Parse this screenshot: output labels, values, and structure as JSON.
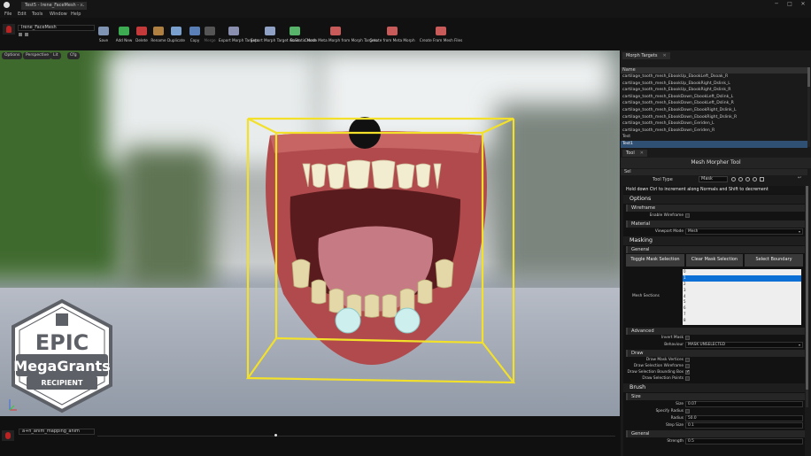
{
  "titlebar": {
    "tab_title": "Test5 - Irene_FaceMesh - ...",
    "close": "✕",
    "minimize": "─",
    "maximize": "□",
    "window_close": "✕"
  },
  "menu": {
    "file": "File",
    "edit": "Edit",
    "tools": "Tools",
    "window": "Window",
    "help": "Help"
  },
  "asset": {
    "name": "Irene_FaceMesh"
  },
  "toolbar": [
    {
      "label": "Save",
      "color": "#7f93b3"
    },
    {
      "label": "Add New",
      "color": "#3cab52"
    },
    {
      "label": "Delete",
      "color": "#c43a3a"
    },
    {
      "label": "Rename",
      "color": "#b08040"
    },
    {
      "label": "Duplicate",
      "color": "#7aa0d0"
    },
    {
      "label": "Copy",
      "color": "#5a7fb6"
    },
    {
      "label": "Merge",
      "color": "#555555"
    },
    {
      "label": "Export Morph Targets",
      "color": "#8a8fb0"
    },
    {
      "label": "Export Morph Target As Static Mesh",
      "color": "#8fa2c6"
    },
    {
      "label": "Bake",
      "color": "#58b36a"
    },
    {
      "label": "Create Meta Morph from Morph Targets",
      "color": "#c85a5a"
    },
    {
      "label": "Create from Meta Morph",
      "color": "#c85a5a"
    },
    {
      "label": "Create From Mesh Files",
      "color": "#c85a5a"
    }
  ],
  "viewport": {
    "options": "Options",
    "perspective": "Perspective",
    "lit": "Lit",
    "show": "Cfg"
  },
  "badge": {
    "line1": "EPIC",
    "line2": "MegaGrants",
    "line3": "RECIPIENT"
  },
  "timeline": {
    "animation": "a+h_anim_mapping_anim"
  },
  "morph_targets": {
    "tab": "Morph Targets",
    "header": "Name",
    "rows": [
      "cartilage_tooth_mesh_EbookUp_EbookLeft_Dsoak_R",
      "cartilage_tooth_mesh_EbookUp_EbookRight_Dslink_L",
      "cartilage_tooth_mesh_EbookUp_EbookRight_Dslink_R",
      "cartilage_tooth_mesh_EbookDown_EbookLeft_Dslink_L",
      "cartilage_tooth_mesh_EbookDown_EbookLeft_Dslink_R",
      "cartilage_tooth_mesh_EbookDown_EbookRight_Dslink_L",
      "cartilage_tooth_mesh_EbookDown_EbookRight_Dslink_R",
      "cartilage_tooth_mesh_EbookDown_Eeriden_L",
      "cartilage_tooth_mesh_EbookDown_Eeriden_R",
      "Test",
      "Test1"
    ],
    "selected_index": 10
  },
  "tool": {
    "tab": "Tool",
    "title": "Mesh Morpher Tool",
    "category": "Sel",
    "tool_type_label": "Tool Type",
    "tool_type_value": "Mask",
    "hint": "Hold down Ctrl to increment along Normals and Shift to decrement",
    "options": "Options",
    "wireframe": "Wireframe",
    "enable_wireframe": "Enable Wireframe",
    "material": "Material",
    "viewport_mode_label": "Viewport Mode",
    "viewport_mode": "Mesh",
    "masking": "Masking",
    "general": "General",
    "toggle_mask": "Toggle Mask Selection",
    "clear_mask": "Clear Mask Selection",
    "select_boundary": "Select Boundary",
    "mesh_sections_label": "Mesh Sections",
    "sections": [
      "0",
      "1",
      "2",
      "3",
      "4",
      "5",
      "6",
      "7",
      "8"
    ],
    "selected_section": 1,
    "advanced": "Advanced",
    "invert_mask": "Invert Mask",
    "behaviour_label": "Behaviour",
    "behaviour": "MASK UNSELECTED",
    "draw": "Draw",
    "draw_mask_vertices": "Draw Mask Vertices",
    "draw_selection_wireframe": "Draw Selection Wireframe",
    "draw_selection_bbox": "Draw Selection Bounding Box",
    "draw_selection_points": "Draw Selection Points",
    "brush": "Brush",
    "size_section": "Size",
    "size_label": "Size",
    "size": "0.07",
    "specify_radius": "Specify Radius",
    "radius_label": "Radius",
    "radius": "50.0",
    "step_size_label": "Step Size",
    "step_size": "0.1",
    "general2": "General",
    "strength_label": "Strength",
    "strength": "0.5"
  }
}
